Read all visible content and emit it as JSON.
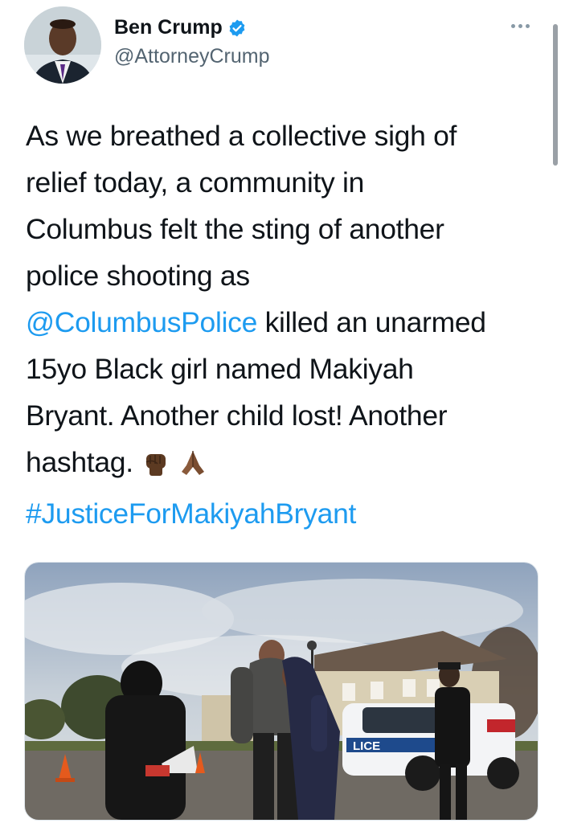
{
  "author": {
    "display_name": "Ben Crump",
    "handle": "@AttorneyCrump",
    "verified": true
  },
  "tweet": {
    "lines": [
      "As we breathed a collective sigh of",
      "relief today, a community in",
      "Columbus felt the sting of another",
      "police shooting as"
    ],
    "mention": "@ColumbusPolice",
    "mention_rest": " killed an unarmed",
    "line6": "15yo Black girl named Makiyah",
    "line7": "Bryant. Another child lost! Another",
    "line8": "hashtag.",
    "hashtag": "#JusticeForMakiyahBryant",
    "emojis": [
      "raised-fist-emoji",
      "folded-hands-emoji"
    ]
  },
  "media": {
    "police_car_text": "LICE"
  },
  "colors": {
    "link": "#1d9bf0",
    "text": "#0f1419",
    "secondary": "#536471",
    "verified": "#1d9bf0"
  },
  "icons": [
    "more-options-icon",
    "verified-badge-icon"
  ]
}
